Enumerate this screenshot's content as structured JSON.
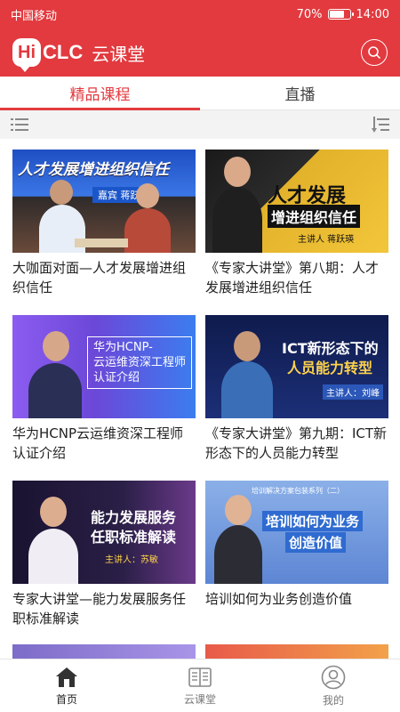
{
  "status": {
    "carrier": "中国移动",
    "battery": "70%",
    "battery_level": 0.7,
    "time": "14:00"
  },
  "app": {
    "logo_hi": "Hi",
    "logo_clc": "CLC",
    "title": "云课堂",
    "search_icon": "search-icon"
  },
  "tabs": [
    {
      "label": "精品课程",
      "active": true
    },
    {
      "label": "直播",
      "active": false
    }
  ],
  "courses": [
    {
      "title": "大咖面对面—人才发展增进组织信任",
      "banner": "人才发展增进组织信任",
      "subtitle": "嘉宾 蒋跃瑛"
    },
    {
      "title": "《专家大讲堂》第八期：人才发展增进组织信任",
      "banner": "人才发展",
      "banner2": "增进组织信任",
      "subtitle": "主讲人 蒋跃瑛"
    },
    {
      "title": "华为HCNP云运维资深工程师认证介绍",
      "banner": "华为HCNP-",
      "banner2": "云运维资深工程师",
      "banner3": "认证介绍"
    },
    {
      "title": "《专家大讲堂》第九期：ICT新形态下的人员能力转型",
      "banner": "ICT新形态下的",
      "banner2": "人员能力转型",
      "subtitle": "主讲人：刘峰"
    },
    {
      "title": "专家大讲堂—能力发展服务任职标准解读",
      "banner": "能力发展服务",
      "banner2": "任职标准解读",
      "subtitle": "主讲人：苏敏"
    },
    {
      "title": "培训如何为业务创造价值",
      "banner": "培训如何为业务",
      "banner2": "创造价值",
      "subtitle": "培训解决方案包装系列（二）"
    }
  ],
  "bottom_nav": [
    {
      "label": "首页",
      "icon": "home-icon",
      "active": true
    },
    {
      "label": "云课堂",
      "icon": "book-icon",
      "active": false
    },
    {
      "label": "我的",
      "icon": "profile-icon",
      "active": false
    }
  ],
  "colors": {
    "brand": "#e23a3f"
  }
}
